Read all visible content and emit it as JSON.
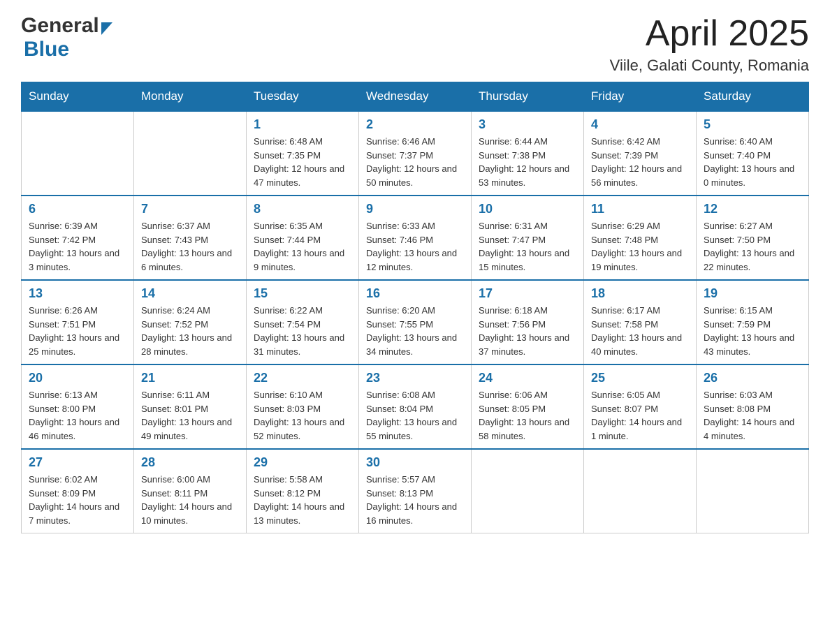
{
  "header": {
    "logo_general": "General",
    "logo_blue": "Blue",
    "month_title": "April 2025",
    "location": "Viile, Galati County, Romania"
  },
  "days_of_week": [
    "Sunday",
    "Monday",
    "Tuesday",
    "Wednesday",
    "Thursday",
    "Friday",
    "Saturday"
  ],
  "weeks": [
    [
      {
        "day": "",
        "sunrise": "",
        "sunset": "",
        "daylight": ""
      },
      {
        "day": "",
        "sunrise": "",
        "sunset": "",
        "daylight": ""
      },
      {
        "day": "1",
        "sunrise": "Sunrise: 6:48 AM",
        "sunset": "Sunset: 7:35 PM",
        "daylight": "Daylight: 12 hours and 47 minutes."
      },
      {
        "day": "2",
        "sunrise": "Sunrise: 6:46 AM",
        "sunset": "Sunset: 7:37 PM",
        "daylight": "Daylight: 12 hours and 50 minutes."
      },
      {
        "day": "3",
        "sunrise": "Sunrise: 6:44 AM",
        "sunset": "Sunset: 7:38 PM",
        "daylight": "Daylight: 12 hours and 53 minutes."
      },
      {
        "day": "4",
        "sunrise": "Sunrise: 6:42 AM",
        "sunset": "Sunset: 7:39 PM",
        "daylight": "Daylight: 12 hours and 56 minutes."
      },
      {
        "day": "5",
        "sunrise": "Sunrise: 6:40 AM",
        "sunset": "Sunset: 7:40 PM",
        "daylight": "Daylight: 13 hours and 0 minutes."
      }
    ],
    [
      {
        "day": "6",
        "sunrise": "Sunrise: 6:39 AM",
        "sunset": "Sunset: 7:42 PM",
        "daylight": "Daylight: 13 hours and 3 minutes."
      },
      {
        "day": "7",
        "sunrise": "Sunrise: 6:37 AM",
        "sunset": "Sunset: 7:43 PM",
        "daylight": "Daylight: 13 hours and 6 minutes."
      },
      {
        "day": "8",
        "sunrise": "Sunrise: 6:35 AM",
        "sunset": "Sunset: 7:44 PM",
        "daylight": "Daylight: 13 hours and 9 minutes."
      },
      {
        "day": "9",
        "sunrise": "Sunrise: 6:33 AM",
        "sunset": "Sunset: 7:46 PM",
        "daylight": "Daylight: 13 hours and 12 minutes."
      },
      {
        "day": "10",
        "sunrise": "Sunrise: 6:31 AM",
        "sunset": "Sunset: 7:47 PM",
        "daylight": "Daylight: 13 hours and 15 minutes."
      },
      {
        "day": "11",
        "sunrise": "Sunrise: 6:29 AM",
        "sunset": "Sunset: 7:48 PM",
        "daylight": "Daylight: 13 hours and 19 minutes."
      },
      {
        "day": "12",
        "sunrise": "Sunrise: 6:27 AM",
        "sunset": "Sunset: 7:50 PM",
        "daylight": "Daylight: 13 hours and 22 minutes."
      }
    ],
    [
      {
        "day": "13",
        "sunrise": "Sunrise: 6:26 AM",
        "sunset": "Sunset: 7:51 PM",
        "daylight": "Daylight: 13 hours and 25 minutes."
      },
      {
        "day": "14",
        "sunrise": "Sunrise: 6:24 AM",
        "sunset": "Sunset: 7:52 PM",
        "daylight": "Daylight: 13 hours and 28 minutes."
      },
      {
        "day": "15",
        "sunrise": "Sunrise: 6:22 AM",
        "sunset": "Sunset: 7:54 PM",
        "daylight": "Daylight: 13 hours and 31 minutes."
      },
      {
        "day": "16",
        "sunrise": "Sunrise: 6:20 AM",
        "sunset": "Sunset: 7:55 PM",
        "daylight": "Daylight: 13 hours and 34 minutes."
      },
      {
        "day": "17",
        "sunrise": "Sunrise: 6:18 AM",
        "sunset": "Sunset: 7:56 PM",
        "daylight": "Daylight: 13 hours and 37 minutes."
      },
      {
        "day": "18",
        "sunrise": "Sunrise: 6:17 AM",
        "sunset": "Sunset: 7:58 PM",
        "daylight": "Daylight: 13 hours and 40 minutes."
      },
      {
        "day": "19",
        "sunrise": "Sunrise: 6:15 AM",
        "sunset": "Sunset: 7:59 PM",
        "daylight": "Daylight: 13 hours and 43 minutes."
      }
    ],
    [
      {
        "day": "20",
        "sunrise": "Sunrise: 6:13 AM",
        "sunset": "Sunset: 8:00 PM",
        "daylight": "Daylight: 13 hours and 46 minutes."
      },
      {
        "day": "21",
        "sunrise": "Sunrise: 6:11 AM",
        "sunset": "Sunset: 8:01 PM",
        "daylight": "Daylight: 13 hours and 49 minutes."
      },
      {
        "day": "22",
        "sunrise": "Sunrise: 6:10 AM",
        "sunset": "Sunset: 8:03 PM",
        "daylight": "Daylight: 13 hours and 52 minutes."
      },
      {
        "day": "23",
        "sunrise": "Sunrise: 6:08 AM",
        "sunset": "Sunset: 8:04 PM",
        "daylight": "Daylight: 13 hours and 55 minutes."
      },
      {
        "day": "24",
        "sunrise": "Sunrise: 6:06 AM",
        "sunset": "Sunset: 8:05 PM",
        "daylight": "Daylight: 13 hours and 58 minutes."
      },
      {
        "day": "25",
        "sunrise": "Sunrise: 6:05 AM",
        "sunset": "Sunset: 8:07 PM",
        "daylight": "Daylight: 14 hours and 1 minute."
      },
      {
        "day": "26",
        "sunrise": "Sunrise: 6:03 AM",
        "sunset": "Sunset: 8:08 PM",
        "daylight": "Daylight: 14 hours and 4 minutes."
      }
    ],
    [
      {
        "day": "27",
        "sunrise": "Sunrise: 6:02 AM",
        "sunset": "Sunset: 8:09 PM",
        "daylight": "Daylight: 14 hours and 7 minutes."
      },
      {
        "day": "28",
        "sunrise": "Sunrise: 6:00 AM",
        "sunset": "Sunset: 8:11 PM",
        "daylight": "Daylight: 14 hours and 10 minutes."
      },
      {
        "day": "29",
        "sunrise": "Sunrise: 5:58 AM",
        "sunset": "Sunset: 8:12 PM",
        "daylight": "Daylight: 14 hours and 13 minutes."
      },
      {
        "day": "30",
        "sunrise": "Sunrise: 5:57 AM",
        "sunset": "Sunset: 8:13 PM",
        "daylight": "Daylight: 14 hours and 16 minutes."
      },
      {
        "day": "",
        "sunrise": "",
        "sunset": "",
        "daylight": ""
      },
      {
        "day": "",
        "sunrise": "",
        "sunset": "",
        "daylight": ""
      },
      {
        "day": "",
        "sunrise": "",
        "sunset": "",
        "daylight": ""
      }
    ]
  ]
}
